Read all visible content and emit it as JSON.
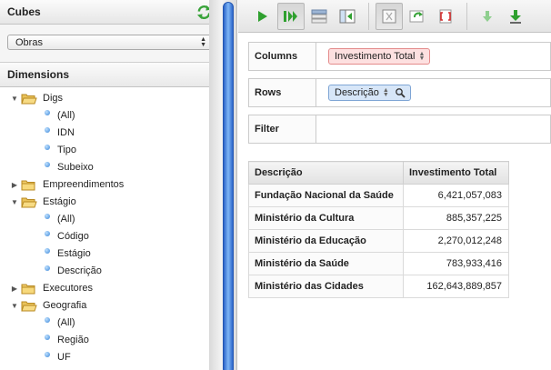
{
  "cubes": {
    "title": "Cubes",
    "refresh_icon": "refresh-icon",
    "selected": "Obras"
  },
  "dimensions": {
    "title": "Dimensions",
    "tree": [
      {
        "label": "Digs",
        "kind": "folder",
        "expanded": true
      },
      {
        "label": "(All)",
        "kind": "leaf"
      },
      {
        "label": "IDN",
        "kind": "leaf"
      },
      {
        "label": "Tipo",
        "kind": "leaf"
      },
      {
        "label": "Subeixo",
        "kind": "leaf"
      },
      {
        "label": "Empreendimentos",
        "kind": "folder",
        "expanded": false
      },
      {
        "label": "Estágio",
        "kind": "folder",
        "expanded": true
      },
      {
        "label": "(All)",
        "kind": "leaf"
      },
      {
        "label": "Código",
        "kind": "leaf"
      },
      {
        "label": "Estágio",
        "kind": "leaf"
      },
      {
        "label": "Descrição",
        "kind": "leaf"
      },
      {
        "label": "Executores",
        "kind": "folder",
        "expanded": false
      },
      {
        "label": "Geografia",
        "kind": "folder",
        "expanded": true
      },
      {
        "label": "(All)",
        "kind": "leaf"
      },
      {
        "label": "Região",
        "kind": "leaf"
      },
      {
        "label": "UF",
        "kind": "leaf"
      }
    ]
  },
  "toolbar": {
    "buttons": [
      "run-icon",
      "auto-run-icon",
      "layout-icon",
      "swap-icon",
      "formula-icon",
      "refresh-query-icon",
      "drill-icon",
      "export-icon"
    ]
  },
  "query": {
    "columns_label": "Columns",
    "rows_label": "Rows",
    "filter_label": "Filter",
    "column_pill": "Investimento Total",
    "row_pill": "Descrição"
  },
  "table": {
    "headers": [
      "Descrição",
      "Investimento Total"
    ],
    "rows": [
      [
        "Fundação Nacional da Saúde",
        "6,421,057,083"
      ],
      [
        "Ministério da Cultura",
        "885,357,225"
      ],
      [
        "Ministério da Educação",
        "2,270,012,248"
      ],
      [
        "Ministério da Saúde",
        "783,933,416"
      ],
      [
        "Ministério das Cidades",
        "162,643,889,857"
      ]
    ]
  },
  "colors": {
    "accent_blue": "#2d67cc",
    "pill_red_bg": "#fde0e0",
    "pill_blue_bg": "#d7e6f8",
    "play_green": "#2fa02f"
  }
}
